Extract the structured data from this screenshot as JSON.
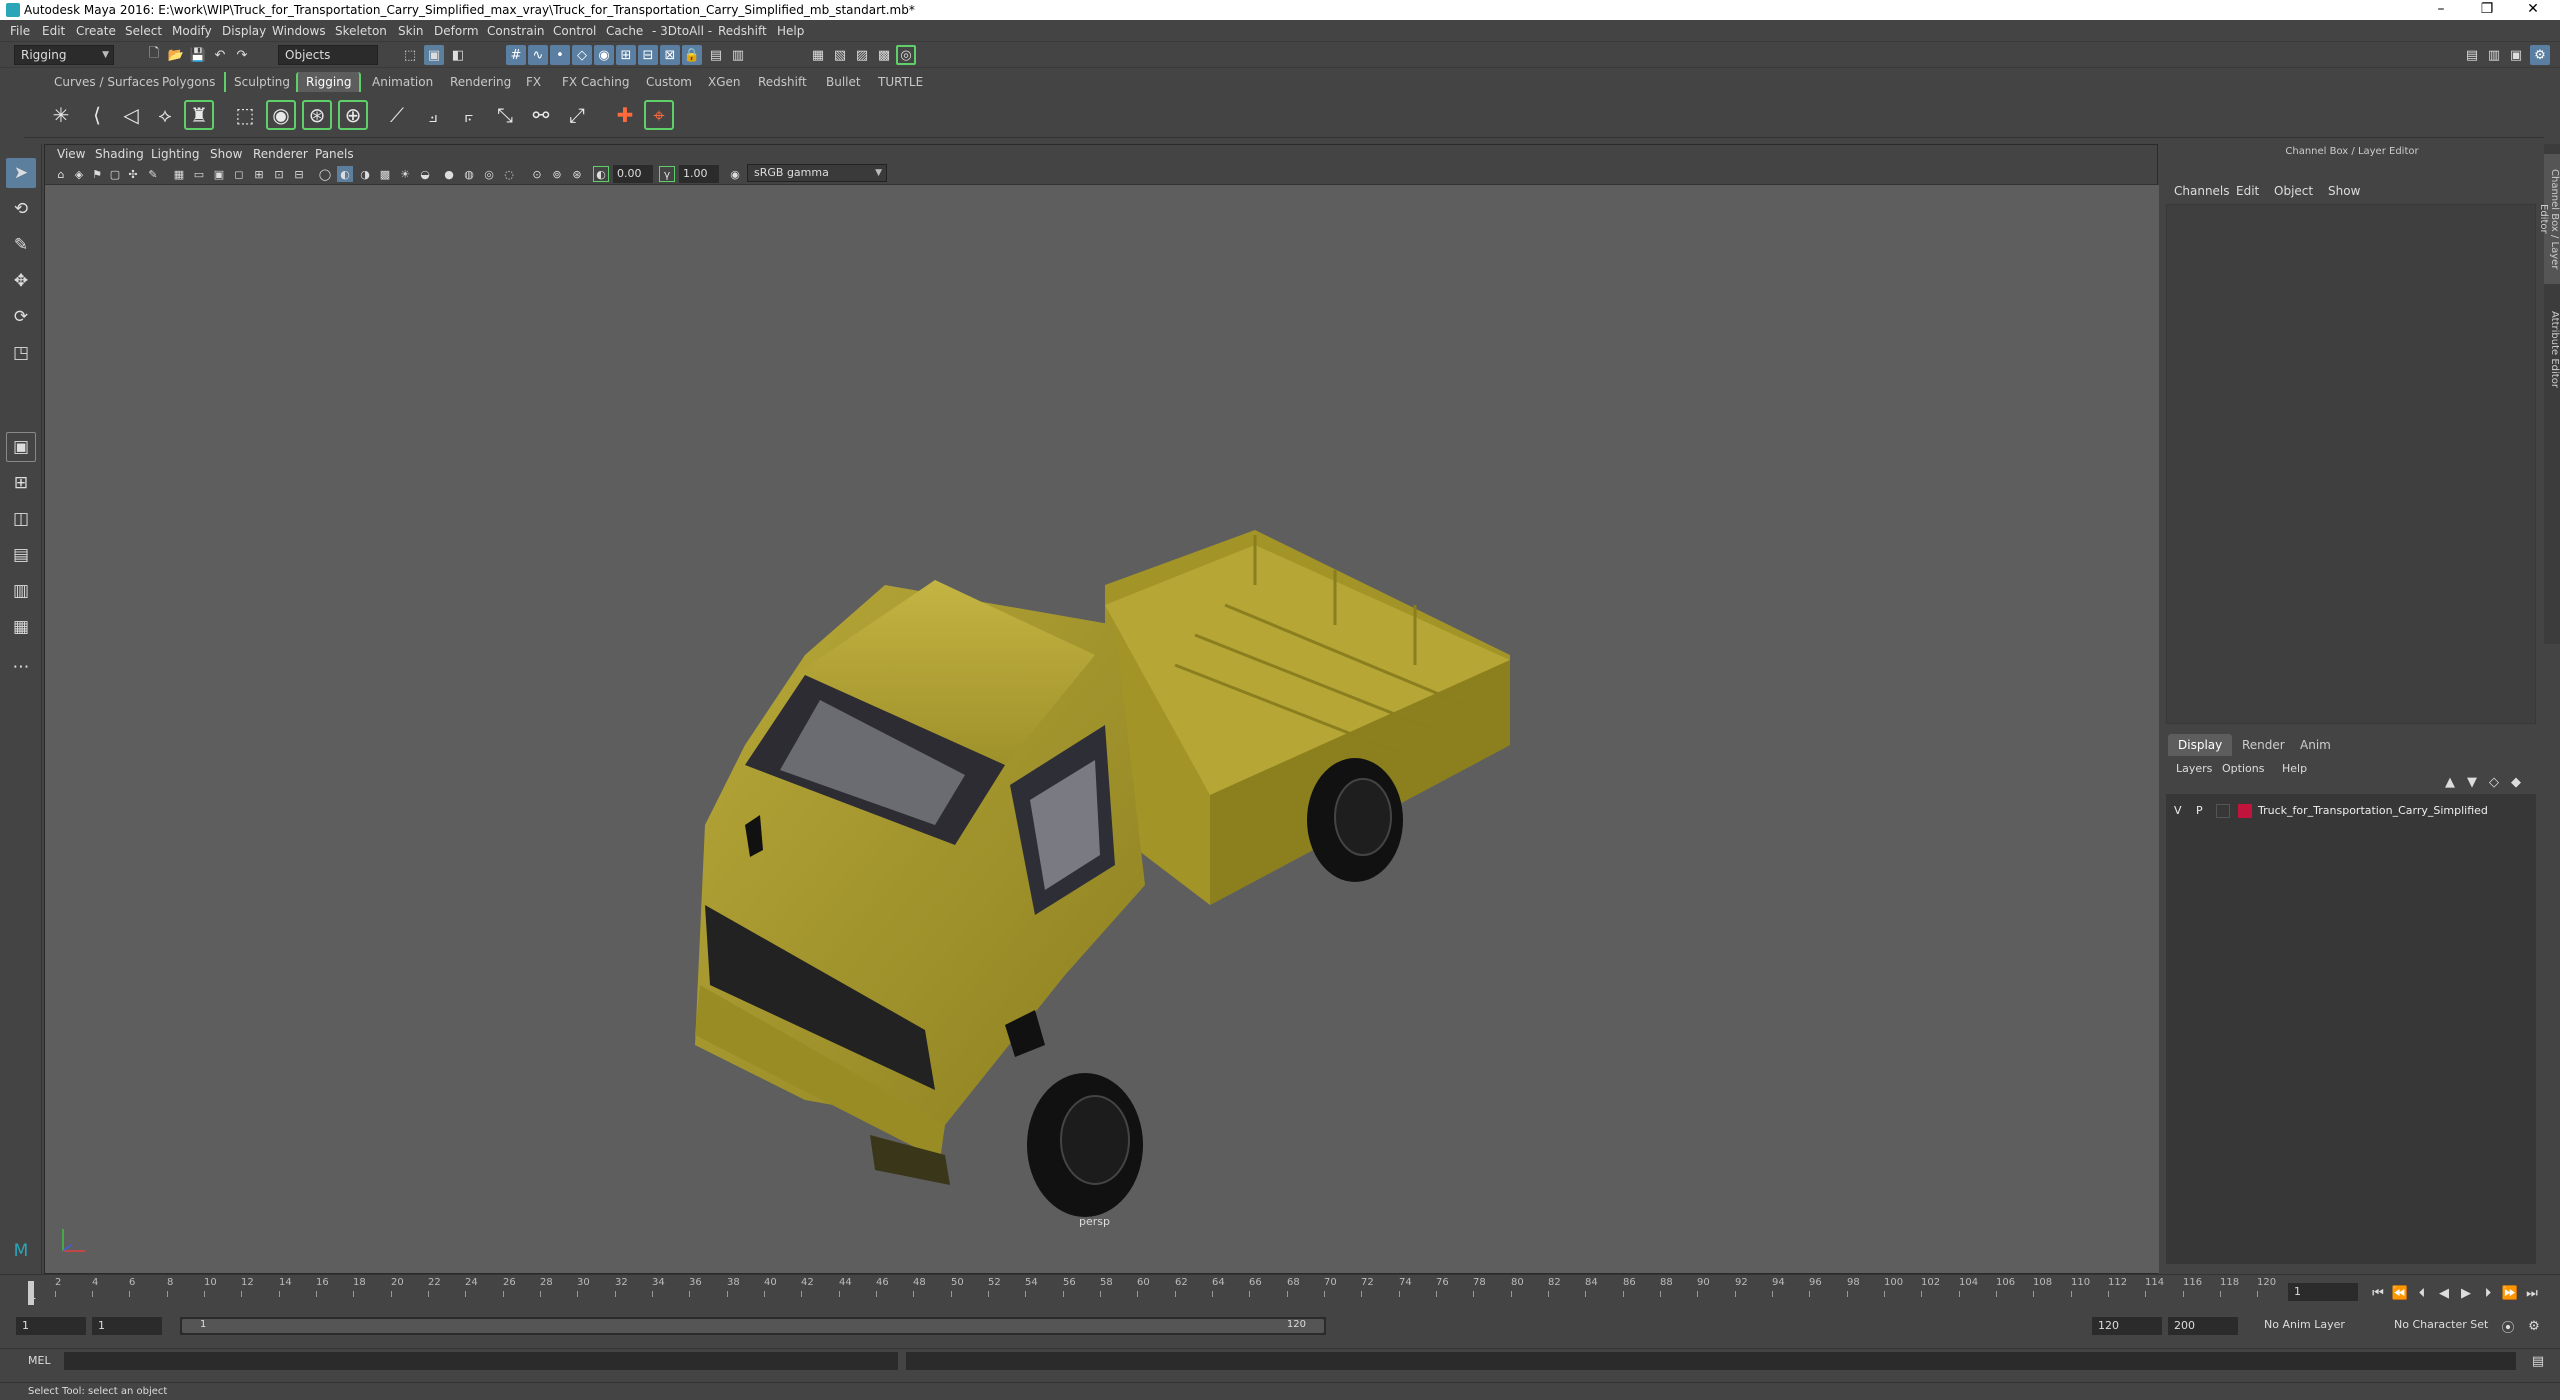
{
  "window": {
    "title": "Autodesk Maya 2016: E:\\work\\WIP\\Truck_for_Transportation_Carry_Simplified_max_vray\\Truck_for_Transportation_Carry_Simplified_mb_standart.mb*",
    "minimize": "–",
    "maximize": "❐",
    "close": "✕"
  },
  "menubar": [
    "File",
    "Edit",
    "Create",
    "Select",
    "Modify",
    "Display",
    "Windows",
    "Skeleton",
    "Skin",
    "Deform",
    "Constrain",
    "Control",
    "Cache",
    "- 3DtoAll -",
    "Redshift",
    "Help"
  ],
  "statusline": {
    "mode": "Rigging",
    "selection_mode": "Objects"
  },
  "shelf_tabs": [
    "Curves / Surfaces",
    "Polygons",
    "Sculpting",
    "Rigging",
    "Animation",
    "Rendering",
    "FX",
    "FX Caching",
    "Custom",
    "XGen",
    "Redshift",
    "Bullet",
    "TURTLE"
  ],
  "active_shelf_tab": "Rigging",
  "viewport": {
    "menu": [
      "View",
      "Shading",
      "Lighting",
      "Show",
      "Renderer",
      "Panels"
    ],
    "field_exposure": "0.00",
    "field_gamma": "1.00",
    "color_space": "sRGB gamma",
    "camera_label": "persp"
  },
  "channel_box": {
    "header": "Channel Box / Layer Editor",
    "menu": [
      "Channels",
      "Edit",
      "Object",
      "Show"
    ]
  },
  "layer_editor": {
    "tabs": [
      "Display",
      "Render",
      "Anim"
    ],
    "active_tab": "Display",
    "menu": [
      "Layers",
      "Options",
      "Help"
    ],
    "layers": [
      {
        "visible": "V",
        "playback": "P",
        "name": "Truck_for_Transportation_Carry_Simplified",
        "color": "#c0143c"
      }
    ]
  },
  "side_tabs": [
    "Channel Box / Layer Editor",
    "Attribute Editor"
  ],
  "timeslider": {
    "ticks": [
      "2",
      "4",
      "6",
      "8",
      "10",
      "12",
      "14",
      "16",
      "18",
      "20",
      "22",
      "24",
      "26",
      "28",
      "30",
      "32",
      "34",
      "36",
      "38",
      "40",
      "42",
      "44",
      "46",
      "48",
      "50",
      "52",
      "54",
      "56",
      "58",
      "60",
      "62",
      "64",
      "66",
      "68",
      "70",
      "72",
      "74",
      "76",
      "78",
      "80",
      "82",
      "84",
      "86",
      "88",
      "90",
      "92",
      "94",
      "96",
      "98",
      "100",
      "102",
      "104",
      "106",
      "108",
      "110",
      "112",
      "114",
      "116",
      "118",
      "120"
    ],
    "current_frame": "1",
    "current_frame_marker": "1"
  },
  "range": {
    "start": "1",
    "playback_start": "1",
    "range_start_label": "1",
    "range_end_label": "120",
    "playback_end": "120",
    "end": "200",
    "anim_layer": "No Anim Layer",
    "character_set": "No Character Set"
  },
  "cmdline": {
    "label": "MEL"
  },
  "helpline": "Select Tool: select an object",
  "colors": {
    "accent_green": "#5fcf6a",
    "accent_blue": "#5d7f9e",
    "truck_body": "#a89a2a"
  }
}
